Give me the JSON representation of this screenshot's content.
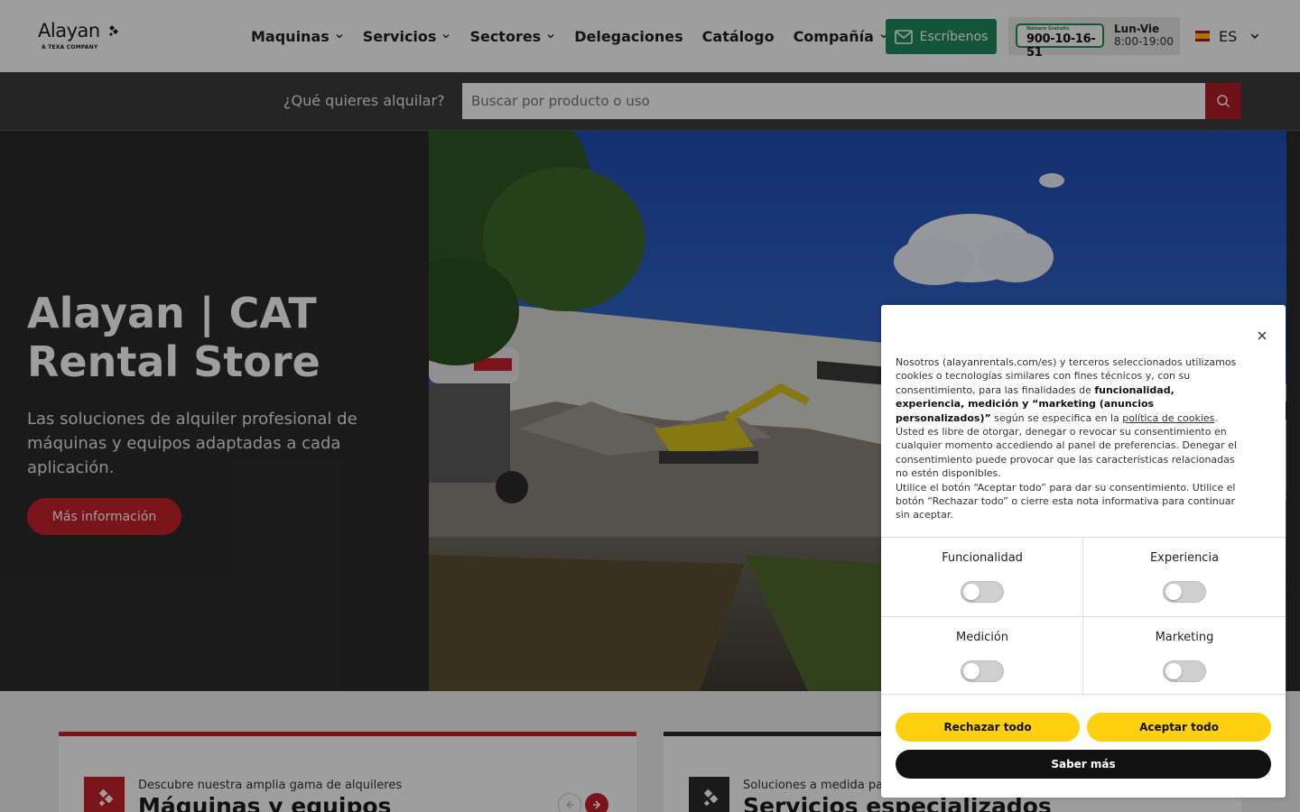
{
  "header": {
    "logo_text": "Alayan",
    "logo_subtext": "A TEXA COMPANY",
    "nav": [
      {
        "label": "Maquinas",
        "has_dropdown": true
      },
      {
        "label": "Servicios",
        "has_dropdown": true
      },
      {
        "label": "Sectores",
        "has_dropdown": true
      },
      {
        "label": "Delegaciones",
        "has_dropdown": false
      },
      {
        "label": "Catálogo",
        "has_dropdown": false
      },
      {
        "label": "Compañía",
        "has_dropdown": true
      }
    ],
    "write_button": "Escríbenos",
    "phone": {
      "badge_caption": "Número Gratuito",
      "number": "900-10-16-51",
      "days": "Lun-Vie",
      "hours": "8:00-19:00"
    },
    "language": "ES"
  },
  "search": {
    "prompt": "¿Qué quieres alquilar?",
    "placeholder": "Buscar por producto o uso"
  },
  "hero": {
    "title": "Alayan | CAT Rental Store",
    "subtitle": "Las soluciones de alquiler profesional de máquinas y equipos adaptadas a cada aplicación.",
    "button": "Más información"
  },
  "cards": [
    {
      "kicker": "Descubre nuestra amplia gama de alquileres",
      "title": "Máquinas y equipos"
    },
    {
      "kicker": "Soluciones a medida para",
      "title": "Servicios especializados"
    }
  ],
  "cookie": {
    "text_intro": "Nosotros (alayanrentals.com/es) y terceros seleccionados utilizamos cookies o tecnologías similares con fines técnicos y, con su consentimiento, para las finalidades de ",
    "text_bold": "funcionalidad, experiencia, medición y “marketing (anuncios personalizados)”",
    "text_mid": " según se especifica en la ",
    "text_link": "política de cookies",
    "text_end": ".",
    "paragraph2": "Usted es libre de otorgar, denegar o revocar su consentimiento en cualquier momento accediendo al panel de preferencias. Denegar el consentimiento puede provocar que las características relacionadas no estén disponibles.",
    "paragraph3": "Utilice el botón “Aceptar todo” para dar su consentimiento. Utilice el botón “Rechazar todo” o cierre esta nota informativa para continuar sin aceptar.",
    "preferences": [
      {
        "label": "Funcionalidad",
        "enabled": false
      },
      {
        "label": "Experiencia",
        "enabled": false
      },
      {
        "label": "Medición",
        "enabled": false
      },
      {
        "label": "Marketing",
        "enabled": false
      }
    ],
    "reject_button": "Rechazar todo",
    "accept_button": "Aceptar todo",
    "more_button": "Saber más"
  },
  "colors": {
    "brand_red": "#c7202b",
    "cta_green": "#1d8a5c",
    "cookie_yellow": "#ffcf10"
  }
}
